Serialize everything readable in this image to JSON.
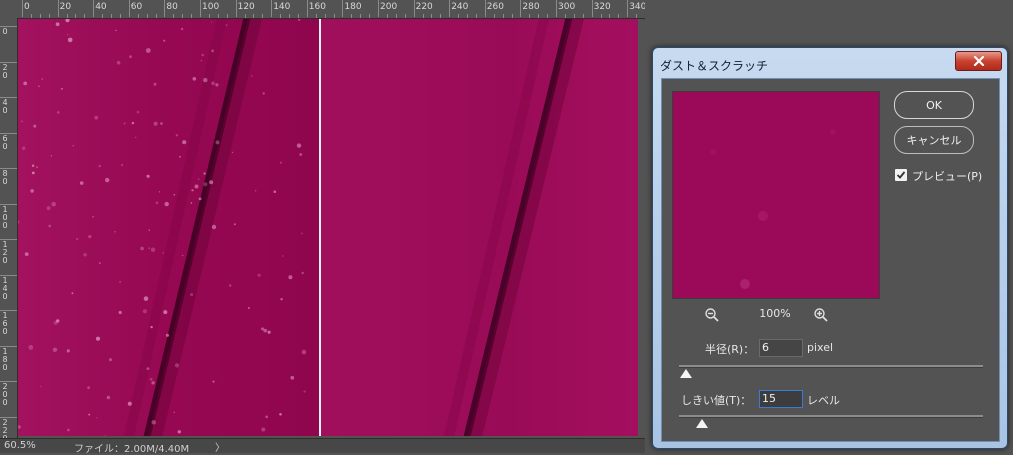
{
  "rulers": {
    "top_ticks": [
      "0",
      "20",
      "40",
      "60",
      "80",
      "100",
      "120",
      "140",
      "160",
      "180",
      "200",
      "220",
      "240",
      "260",
      "280",
      "300",
      "320",
      "340"
    ],
    "left_ticks": [
      "0",
      "2 0",
      "4 0",
      "6 0",
      "8 0",
      "1 0 0",
      "1 2 0",
      "1 4 0",
      "1 6 0",
      "1 8 0",
      "2 0 0",
      "2 2 0"
    ]
  },
  "status_bar": {
    "zoom": "60.5%",
    "file_info": "ファイル：2.00M/4.40M",
    "arrow": "〉"
  },
  "dialog": {
    "title": "ダスト＆スクラッチ",
    "close_icon": "close-icon",
    "ok_label": "OK",
    "cancel_label": "キャンセル",
    "preview_checkbox": {
      "label": "プレビュー(P)",
      "checked": true
    },
    "zoom_level": "100%",
    "radius": {
      "label": "半径(R)：",
      "value": "6",
      "unit": "pixel"
    },
    "threshold": {
      "label": "しきい値(T)：",
      "value": "15",
      "unit": "レベル"
    }
  },
  "colors": {
    "canvas": "#9b0b56",
    "workspace": "#535353",
    "dialog_frame": "#b4cce8"
  }
}
